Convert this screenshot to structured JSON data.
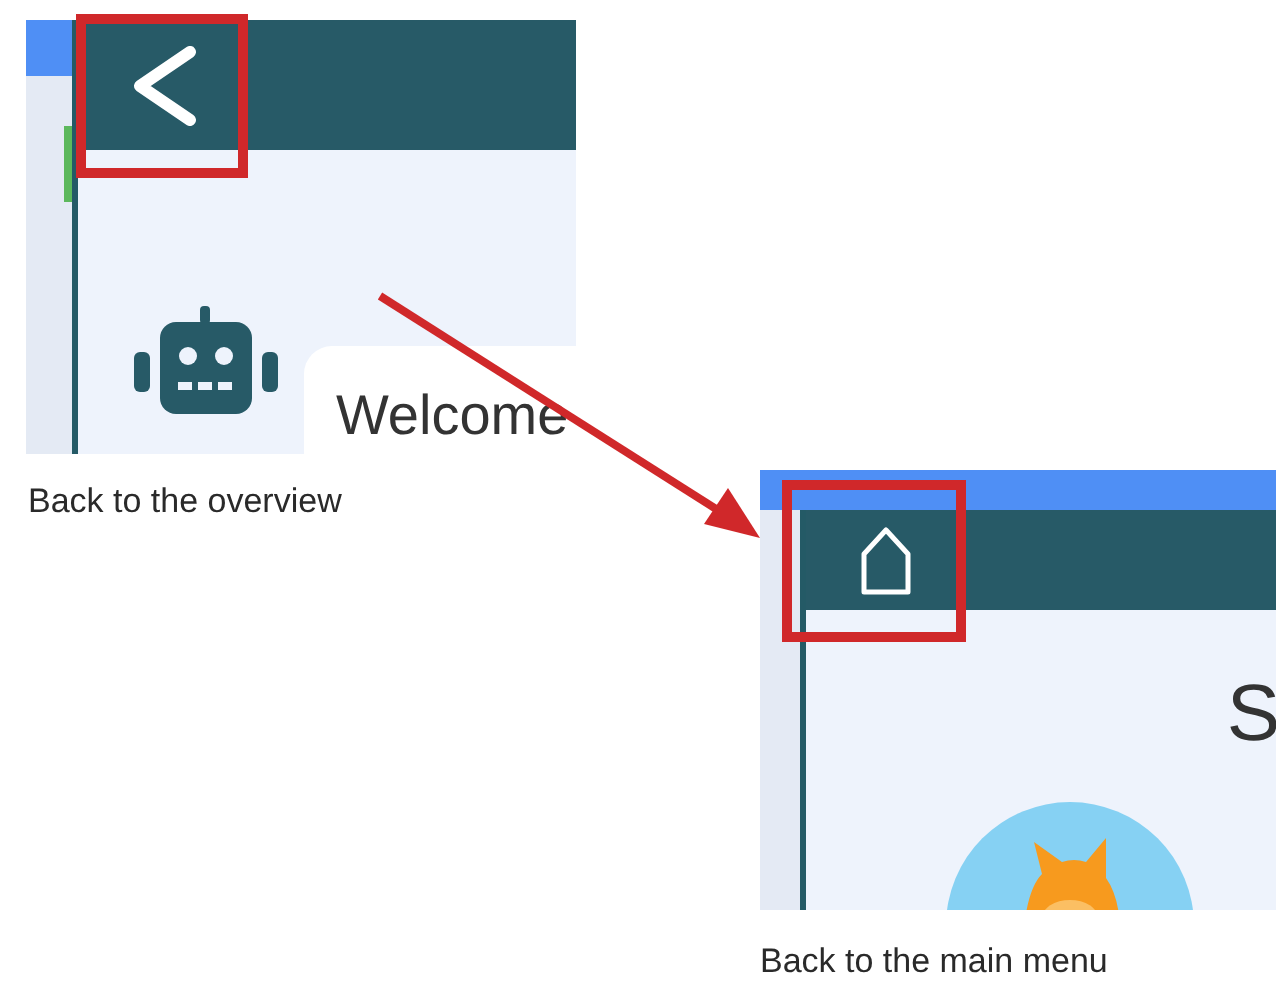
{
  "panels": [
    {
      "kind": "overview",
      "nav_button": {
        "kind": "back"
      },
      "heading": "Welcome",
      "caption": "Back to the overview"
    },
    {
      "kind": "menu",
      "nav_button": {
        "kind": "home"
      },
      "heading": "S",
      "caption": "Back to the main menu"
    }
  ]
}
